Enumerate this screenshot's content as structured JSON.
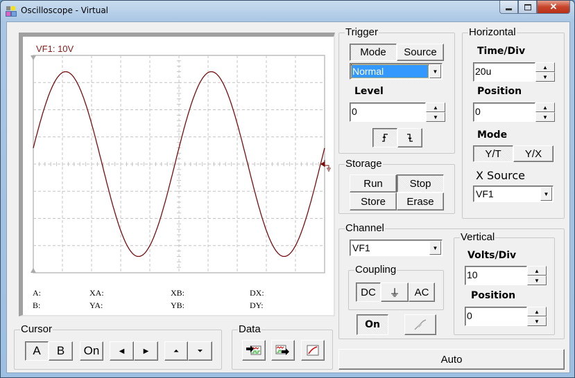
{
  "window": {
    "title": "Oscilloscope - Virtual",
    "controls": {
      "minimize": "minimize-icon",
      "maximize": "maximize-icon",
      "close": "close-icon"
    }
  },
  "screen": {
    "channel_label": "VF1: 10V",
    "trace_color": "#7a0c0c",
    "readouts": {
      "a": "A:",
      "b": "B:",
      "xa": "XA:",
      "ya": "YA:",
      "xb": "XB:",
      "yb": "YB:",
      "dx": "DX:",
      "dy": "DY:"
    }
  },
  "chart_data": {
    "type": "line",
    "title": "VF1: 10V",
    "xlabel": "",
    "ylabel": "",
    "x_divisions": 10,
    "y_divisions": 8,
    "time_per_div_us": 20,
    "volts_per_div": 10,
    "xlim_us": [
      0,
      200
    ],
    "ylim_v": [
      -40,
      40
    ],
    "grid": true,
    "series": [
      {
        "name": "VF1",
        "waveform": "sine",
        "amplitude_v": 34,
        "period_us": 100,
        "phase_deg": 10,
        "offset_v": 0
      }
    ]
  },
  "trigger": {
    "title": "Trigger",
    "tabs": [
      "Mode",
      "Source"
    ],
    "active_tab": "Mode",
    "mode_value": "Normal",
    "level_label": "Level",
    "level_value": "0",
    "edges": [
      "rising-edge-icon",
      "falling-edge-icon"
    ]
  },
  "horizontal": {
    "title": "Horizontal",
    "time_div_label": "Time/Div",
    "time_div_value": "20u",
    "position_label": "Position",
    "position_value": "0",
    "mode_label": "Mode",
    "modes": [
      "Y/T",
      "Y/X"
    ],
    "active_mode": "Y/T",
    "xsource_label": "X Source",
    "xsource_value": "VF1"
  },
  "storage": {
    "title": "Storage",
    "buttons": [
      "Run",
      "Stop",
      "Store",
      "Erase"
    ],
    "active": "Stop"
  },
  "channel": {
    "title": "Channel",
    "value": "VF1",
    "coupling_title": "Coupling",
    "coupling": [
      "DC",
      "⏚",
      "AC"
    ],
    "active_coupling": "DC",
    "on_label": "On"
  },
  "vertical": {
    "title": "Vertical",
    "volts_div_label": "Volts/Div",
    "volts_div_value": "10",
    "position_label": "Position",
    "position_value": "0"
  },
  "cursor": {
    "title": "Cursor",
    "a_label": "A",
    "b_label": "B",
    "on_label": "On"
  },
  "data_group": {
    "title": "Data"
  },
  "auto_label": "Auto"
}
